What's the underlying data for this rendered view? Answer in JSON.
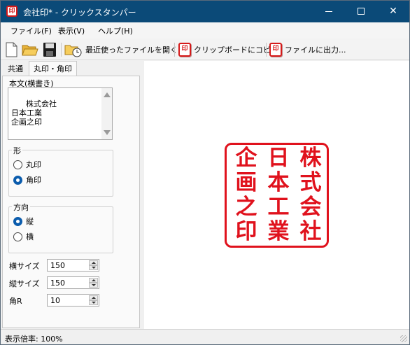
{
  "window": {
    "title": "会社印* - クリックスタンパー",
    "icon_text": "印"
  },
  "menu": {
    "file": "ファイル(F)",
    "view": "表示(V)",
    "help": "ヘルプ(H)"
  },
  "toolbar": {
    "recent_label": "最近使ったファイルを開く...",
    "copy_label": "クリップボードにコピー",
    "export_label": "ファイルに出力...",
    "stamp_icon_text": "印"
  },
  "tabs": {
    "common": "共通",
    "shape_tab": "丸印・角印"
  },
  "form": {
    "body_label": "本文(横書き)",
    "body_text": "株式会社\n日本工業\n企画之印",
    "shape_group": "形",
    "shape_options": [
      "丸印",
      "角印"
    ],
    "shape_selected": "角印",
    "direction_group": "方向",
    "direction_options": [
      "縦",
      "横"
    ],
    "direction_selected": "縦",
    "width_label": "横サイズ",
    "width_value": "150",
    "height_label": "縦サイズ",
    "height_value": "150",
    "corner_label": "角R",
    "corner_value": "10"
  },
  "stamp": {
    "color": "#e0121d",
    "columns": [
      [
        "株",
        "式",
        "会",
        "社"
      ],
      [
        "日",
        "本",
        "工",
        "業"
      ],
      [
        "企",
        "画",
        "之",
        "印"
      ]
    ]
  },
  "status": {
    "zoom_text": "表示倍率: 100%"
  }
}
